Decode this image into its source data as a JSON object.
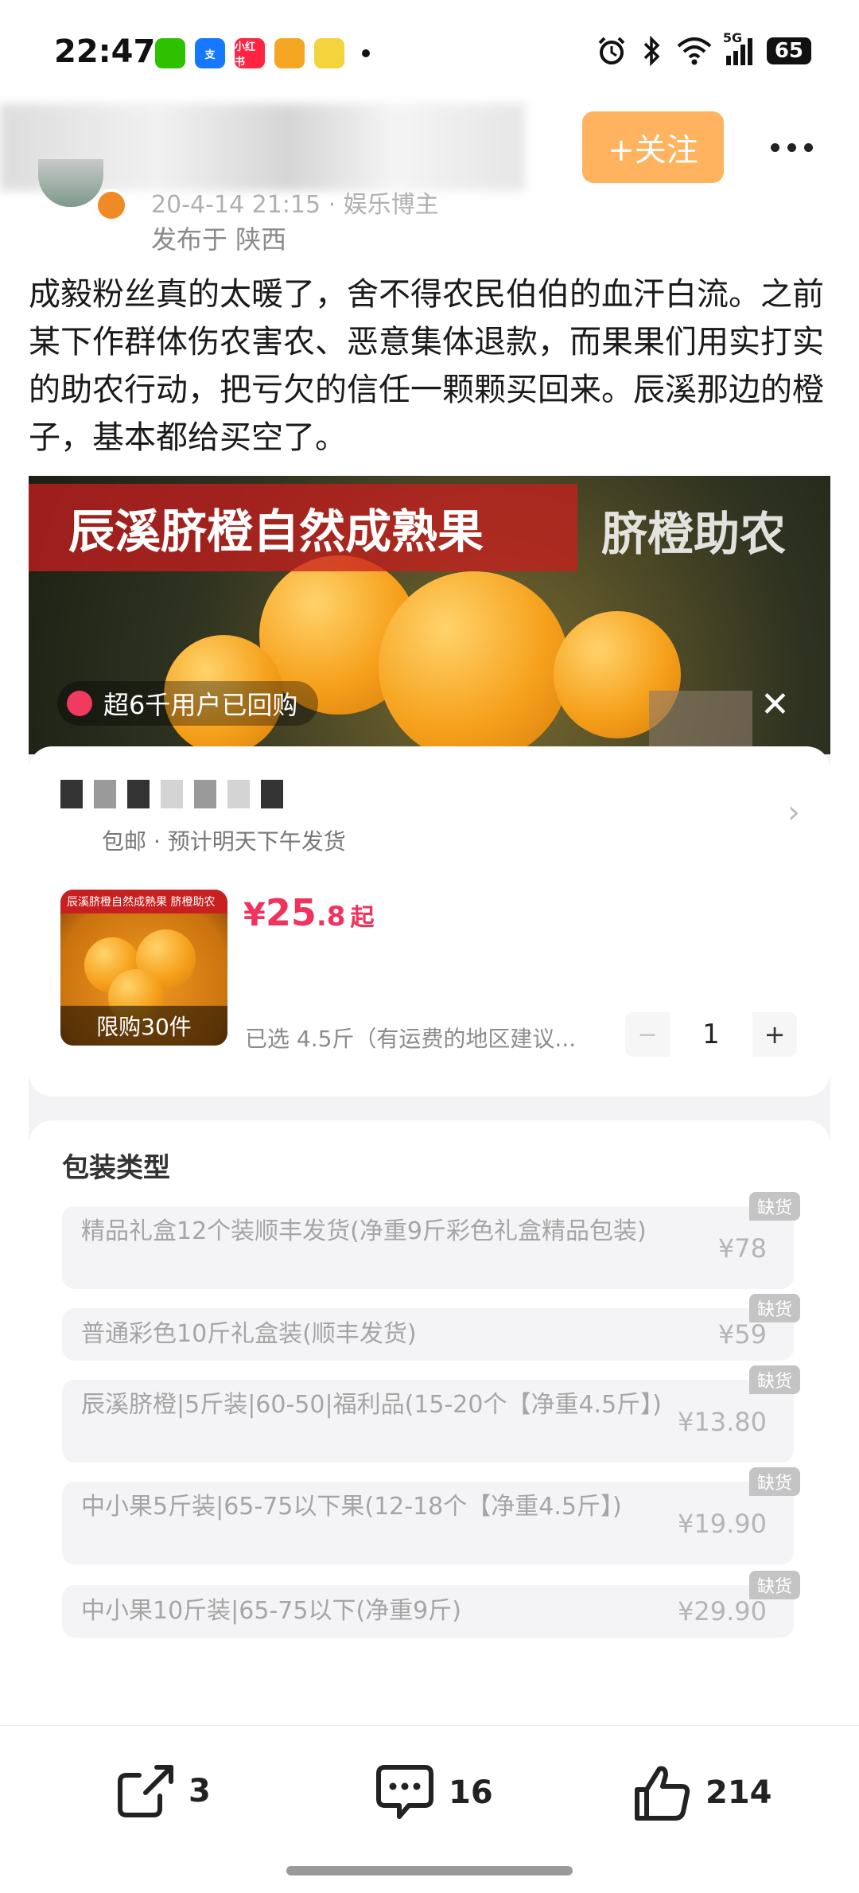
{
  "status_bar": {
    "time": "22:47",
    "apps": [
      {
        "name": "wechat-icon",
        "label": "",
        "color": "#2dc100"
      },
      {
        "name": "alipay-icon",
        "label": "支",
        "color": "#1677ff"
      },
      {
        "name": "xiaohongshu-icon",
        "label": "小红书",
        "color": "#ff2442"
      },
      {
        "name": "weibo-icon",
        "label": "",
        "color": "#f5a623"
      },
      {
        "name": "video-app-icon",
        "label": "",
        "color": "#f3d43c"
      }
    ],
    "network": "5G",
    "battery": "65"
  },
  "header": {
    "meta": "20-4-14 21:15 · 娱乐博主",
    "location": "发布于 陕西",
    "follow_label": "+关注"
  },
  "post": {
    "text": "成毅粉丝真的太暖了，舍不得农民伯伯的血汗白流。之前某下作群体伤农害农、恶意集体退款，而果果们用实打实的助农行动，把亏欠的信任一颗颗买回来。辰溪那边的橙子，基本都给买空了。"
  },
  "screenshot": {
    "banner_title": "辰溪脐橙自然成熟果",
    "banner_title2": "脐橙助农",
    "repurchase": "超6千用户已回购",
    "shipping": "包邮 · 预计明天下午发货",
    "product_strip": "辰溪脐橙自然成熟果 脐橙助农",
    "limit": "限购30件",
    "price": {
      "yen": "¥",
      "int": "25",
      "dec": ".8",
      "suffix": "起"
    },
    "selected": "已选 4.5斤（有运费的地区建议...",
    "quantity": "1",
    "pack_title": "包装类型",
    "options": [
      {
        "label": "精品礼盒12个装顺丰发货(净重9斤彩色礼盒精品包装)",
        "price": "¥78",
        "tag": "缺货"
      },
      {
        "label": "普通彩色10斤礼盒装(顺丰发货)",
        "price": "¥59",
        "tag": "缺货"
      },
      {
        "label": "辰溪脐橙|5斤装|60-50|福利品(15-20个【净重4.5斤】)",
        "price": "¥13.80",
        "tag": "缺货"
      },
      {
        "label": "中小果5斤装|65-75以下果(12-18个【净重4.5斤】)",
        "price": "¥19.90",
        "tag": "缺货"
      },
      {
        "label": "中小果10斤装|65-75以下(净重9斤)",
        "price": "¥29.90",
        "tag": "缺货"
      }
    ]
  },
  "actions": {
    "share_count": "3",
    "comment_count": "16",
    "like_count": "214"
  },
  "colors": {
    "follow": "#ffb35e",
    "price": "#f0335c"
  }
}
